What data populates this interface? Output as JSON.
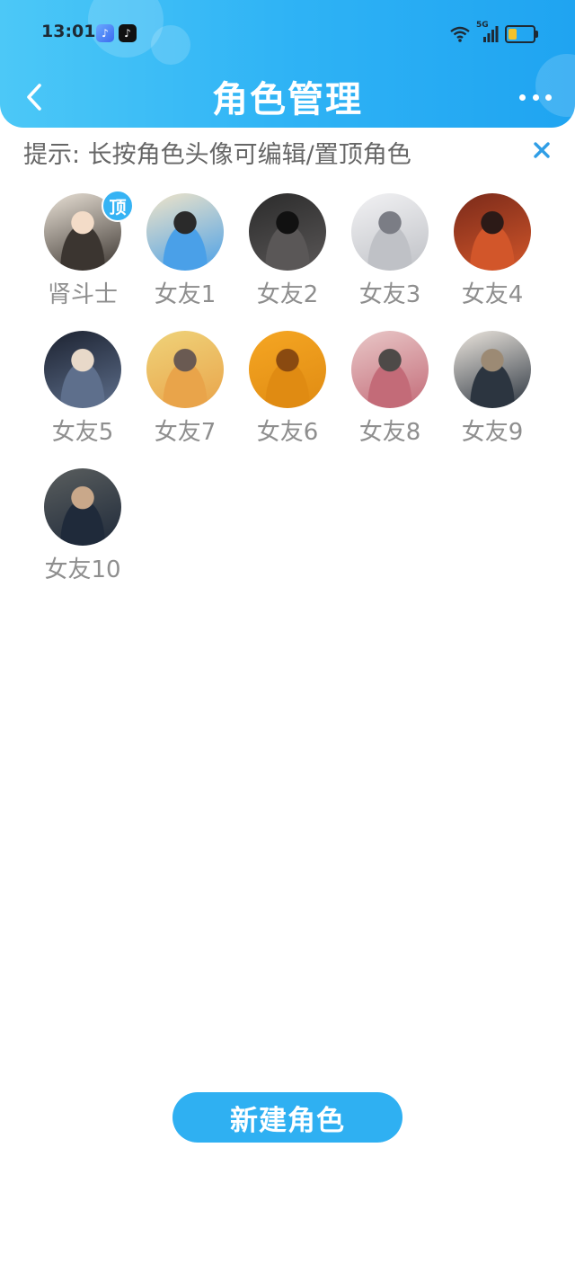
{
  "status_bar": {
    "time": "13:01",
    "network": "5G"
  },
  "header": {
    "title": "角色管理"
  },
  "tip": {
    "text": "提示: 长按角色头像可编辑/置顶角色"
  },
  "roles": [
    {
      "name": "肾斗士",
      "pinned": true,
      "pin_label": "顶",
      "colors": [
        "#e9e1d6",
        "#3b3530",
        "#f3dcc8"
      ]
    },
    {
      "name": "女友1",
      "pinned": false,
      "colors": [
        "#f0e4c8",
        "#4aa0e8",
        "#2a2a2a"
      ]
    },
    {
      "name": "女友2",
      "pinned": false,
      "colors": [
        "#2b2b2b",
        "#5a5757",
        "#111111"
      ]
    },
    {
      "name": "女友3",
      "pinned": false,
      "colors": [
        "#f2f2f4",
        "#bfc1c6",
        "#7b7d85"
      ]
    },
    {
      "name": "女友4",
      "pinned": false,
      "colors": [
        "#7a2a1a",
        "#d2562a",
        "#2c1a17"
      ]
    },
    {
      "name": "女友5",
      "pinned": false,
      "colors": [
        "#1c2230",
        "#5e6f8c",
        "#e8d9c9"
      ]
    },
    {
      "name": "女友7",
      "pinned": false,
      "colors": [
        "#efd37a",
        "#e9a44a",
        "#6a5a52"
      ]
    },
    {
      "name": "女友6",
      "pinned": false,
      "colors": [
        "#f5a623",
        "#e08b12",
        "#8a4a10"
      ]
    },
    {
      "name": "女友8",
      "pinned": false,
      "colors": [
        "#e9c8c8",
        "#c36b78",
        "#4e4a48"
      ]
    },
    {
      "name": "女友9",
      "pinned": false,
      "colors": [
        "#ece6de",
        "#2c3540",
        "#9c8a74"
      ]
    },
    {
      "name": "女友10",
      "pinned": false,
      "colors": [
        "#5a5e5e",
        "#1f2a3a",
        "#c9a88a"
      ]
    }
  ],
  "actions": {
    "new_role_label": "新建角色"
  },
  "colors": {
    "accent": "#2fb0f2",
    "header_start": "#4cc8f7",
    "header_end": "#1fa4f1",
    "name_text": "#8e8e8e",
    "tip_text": "#666666"
  }
}
